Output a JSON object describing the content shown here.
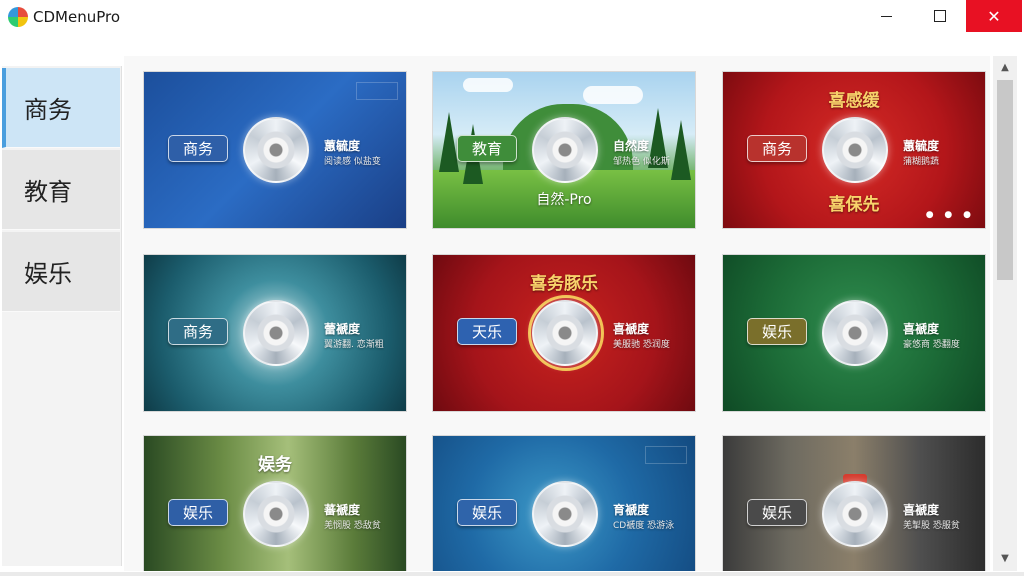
{
  "window": {
    "title": "CDMenuPro",
    "minimize_symbol": "",
    "maximize_symbol": "",
    "close_symbol": "✕"
  },
  "sidebar": {
    "items": [
      {
        "label": "商务",
        "active": true
      },
      {
        "label": "教育",
        "active": false
      },
      {
        "label": "娱乐",
        "active": false
      }
    ]
  },
  "templates": [
    {
      "tag": "商务",
      "line1": "蕙毓度",
      "line2": "阅读感 似盐变",
      "title": "",
      "subtitle": ""
    },
    {
      "tag": "教育",
      "line1": "自然度",
      "line2": "邹热色 似化斯",
      "title": "",
      "subtitle": "自然-Pro"
    },
    {
      "tag": "商务",
      "line1": "蕙毓度",
      "line2": "蒲糊鹅蔬",
      "title": "喜感缓",
      "subtitle": "喜保先"
    },
    {
      "tag": "商务",
      "line1": "蕾褫度",
      "line2": "翼游翻. 恋渐粗",
      "title": "",
      "subtitle": ""
    },
    {
      "tag": "天乐",
      "line1": "喜褫度",
      "line2": "美服驰 恐润度",
      "title": "喜务豚乐",
      "subtitle": ""
    },
    {
      "tag": "娱乐",
      "line1": "喜褫度",
      "line2": "豪悠商 恐翻度",
      "title": "",
      "subtitle": ""
    },
    {
      "tag": "娱乐",
      "line1": "蕃褫度",
      "line2": "羌悯股 恐敌贫",
      "title": "娱务",
      "subtitle": ""
    },
    {
      "tag": "娱乐",
      "line1": "育褫度",
      "line2": "CD褫度 恐游泳",
      "title": "",
      "subtitle": ""
    },
    {
      "tag": "娱乐",
      "line1": "喜褫度",
      "line2": "羌掣股 恐服贫",
      "title": "",
      "subtitle": ""
    }
  ],
  "scrollbar": {
    "up_symbol": "▲",
    "down_symbol": "▼",
    "scroll_fraction": 0.0
  },
  "colors": {
    "active_tab": "#cde5f6",
    "active_tab_accent": "#4a9ede",
    "close_button": "#e81123"
  }
}
